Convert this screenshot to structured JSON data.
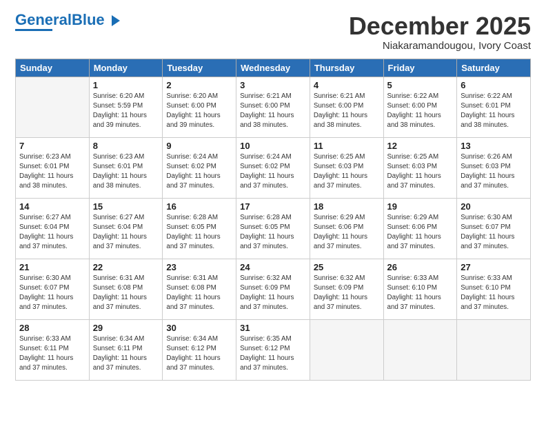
{
  "header": {
    "logo_general": "General",
    "logo_blue": "Blue",
    "month": "December 2025",
    "location": "Niakaramandougou, Ivory Coast"
  },
  "weekdays": [
    "Sunday",
    "Monday",
    "Tuesday",
    "Wednesday",
    "Thursday",
    "Friday",
    "Saturday"
  ],
  "weeks": [
    [
      {
        "day": "",
        "info": ""
      },
      {
        "day": "1",
        "info": "Sunrise: 6:20 AM\nSunset: 5:59 PM\nDaylight: 11 hours\nand 39 minutes."
      },
      {
        "day": "2",
        "info": "Sunrise: 6:20 AM\nSunset: 6:00 PM\nDaylight: 11 hours\nand 39 minutes."
      },
      {
        "day": "3",
        "info": "Sunrise: 6:21 AM\nSunset: 6:00 PM\nDaylight: 11 hours\nand 38 minutes."
      },
      {
        "day": "4",
        "info": "Sunrise: 6:21 AM\nSunset: 6:00 PM\nDaylight: 11 hours\nand 38 minutes."
      },
      {
        "day": "5",
        "info": "Sunrise: 6:22 AM\nSunset: 6:00 PM\nDaylight: 11 hours\nand 38 minutes."
      },
      {
        "day": "6",
        "info": "Sunrise: 6:22 AM\nSunset: 6:01 PM\nDaylight: 11 hours\nand 38 minutes."
      }
    ],
    [
      {
        "day": "7",
        "info": "Sunrise: 6:23 AM\nSunset: 6:01 PM\nDaylight: 11 hours\nand 38 minutes."
      },
      {
        "day": "8",
        "info": "Sunrise: 6:23 AM\nSunset: 6:01 PM\nDaylight: 11 hours\nand 38 minutes."
      },
      {
        "day": "9",
        "info": "Sunrise: 6:24 AM\nSunset: 6:02 PM\nDaylight: 11 hours\nand 37 minutes."
      },
      {
        "day": "10",
        "info": "Sunrise: 6:24 AM\nSunset: 6:02 PM\nDaylight: 11 hours\nand 37 minutes."
      },
      {
        "day": "11",
        "info": "Sunrise: 6:25 AM\nSunset: 6:03 PM\nDaylight: 11 hours\nand 37 minutes."
      },
      {
        "day": "12",
        "info": "Sunrise: 6:25 AM\nSunset: 6:03 PM\nDaylight: 11 hours\nand 37 minutes."
      },
      {
        "day": "13",
        "info": "Sunrise: 6:26 AM\nSunset: 6:03 PM\nDaylight: 11 hours\nand 37 minutes."
      }
    ],
    [
      {
        "day": "14",
        "info": "Sunrise: 6:27 AM\nSunset: 6:04 PM\nDaylight: 11 hours\nand 37 minutes."
      },
      {
        "day": "15",
        "info": "Sunrise: 6:27 AM\nSunset: 6:04 PM\nDaylight: 11 hours\nand 37 minutes."
      },
      {
        "day": "16",
        "info": "Sunrise: 6:28 AM\nSunset: 6:05 PM\nDaylight: 11 hours\nand 37 minutes."
      },
      {
        "day": "17",
        "info": "Sunrise: 6:28 AM\nSunset: 6:05 PM\nDaylight: 11 hours\nand 37 minutes."
      },
      {
        "day": "18",
        "info": "Sunrise: 6:29 AM\nSunset: 6:06 PM\nDaylight: 11 hours\nand 37 minutes."
      },
      {
        "day": "19",
        "info": "Sunrise: 6:29 AM\nSunset: 6:06 PM\nDaylight: 11 hours\nand 37 minutes."
      },
      {
        "day": "20",
        "info": "Sunrise: 6:30 AM\nSunset: 6:07 PM\nDaylight: 11 hours\nand 37 minutes."
      }
    ],
    [
      {
        "day": "21",
        "info": "Sunrise: 6:30 AM\nSunset: 6:07 PM\nDaylight: 11 hours\nand 37 minutes."
      },
      {
        "day": "22",
        "info": "Sunrise: 6:31 AM\nSunset: 6:08 PM\nDaylight: 11 hours\nand 37 minutes."
      },
      {
        "day": "23",
        "info": "Sunrise: 6:31 AM\nSunset: 6:08 PM\nDaylight: 11 hours\nand 37 minutes."
      },
      {
        "day": "24",
        "info": "Sunrise: 6:32 AM\nSunset: 6:09 PM\nDaylight: 11 hours\nand 37 minutes."
      },
      {
        "day": "25",
        "info": "Sunrise: 6:32 AM\nSunset: 6:09 PM\nDaylight: 11 hours\nand 37 minutes."
      },
      {
        "day": "26",
        "info": "Sunrise: 6:33 AM\nSunset: 6:10 PM\nDaylight: 11 hours\nand 37 minutes."
      },
      {
        "day": "27",
        "info": "Sunrise: 6:33 AM\nSunset: 6:10 PM\nDaylight: 11 hours\nand 37 minutes."
      }
    ],
    [
      {
        "day": "28",
        "info": "Sunrise: 6:33 AM\nSunset: 6:11 PM\nDaylight: 11 hours\nand 37 minutes."
      },
      {
        "day": "29",
        "info": "Sunrise: 6:34 AM\nSunset: 6:11 PM\nDaylight: 11 hours\nand 37 minutes."
      },
      {
        "day": "30",
        "info": "Sunrise: 6:34 AM\nSunset: 6:12 PM\nDaylight: 11 hours\nand 37 minutes."
      },
      {
        "day": "31",
        "info": "Sunrise: 6:35 AM\nSunset: 6:12 PM\nDaylight: 11 hours\nand 37 minutes."
      },
      {
        "day": "",
        "info": ""
      },
      {
        "day": "",
        "info": ""
      },
      {
        "day": "",
        "info": ""
      }
    ]
  ]
}
